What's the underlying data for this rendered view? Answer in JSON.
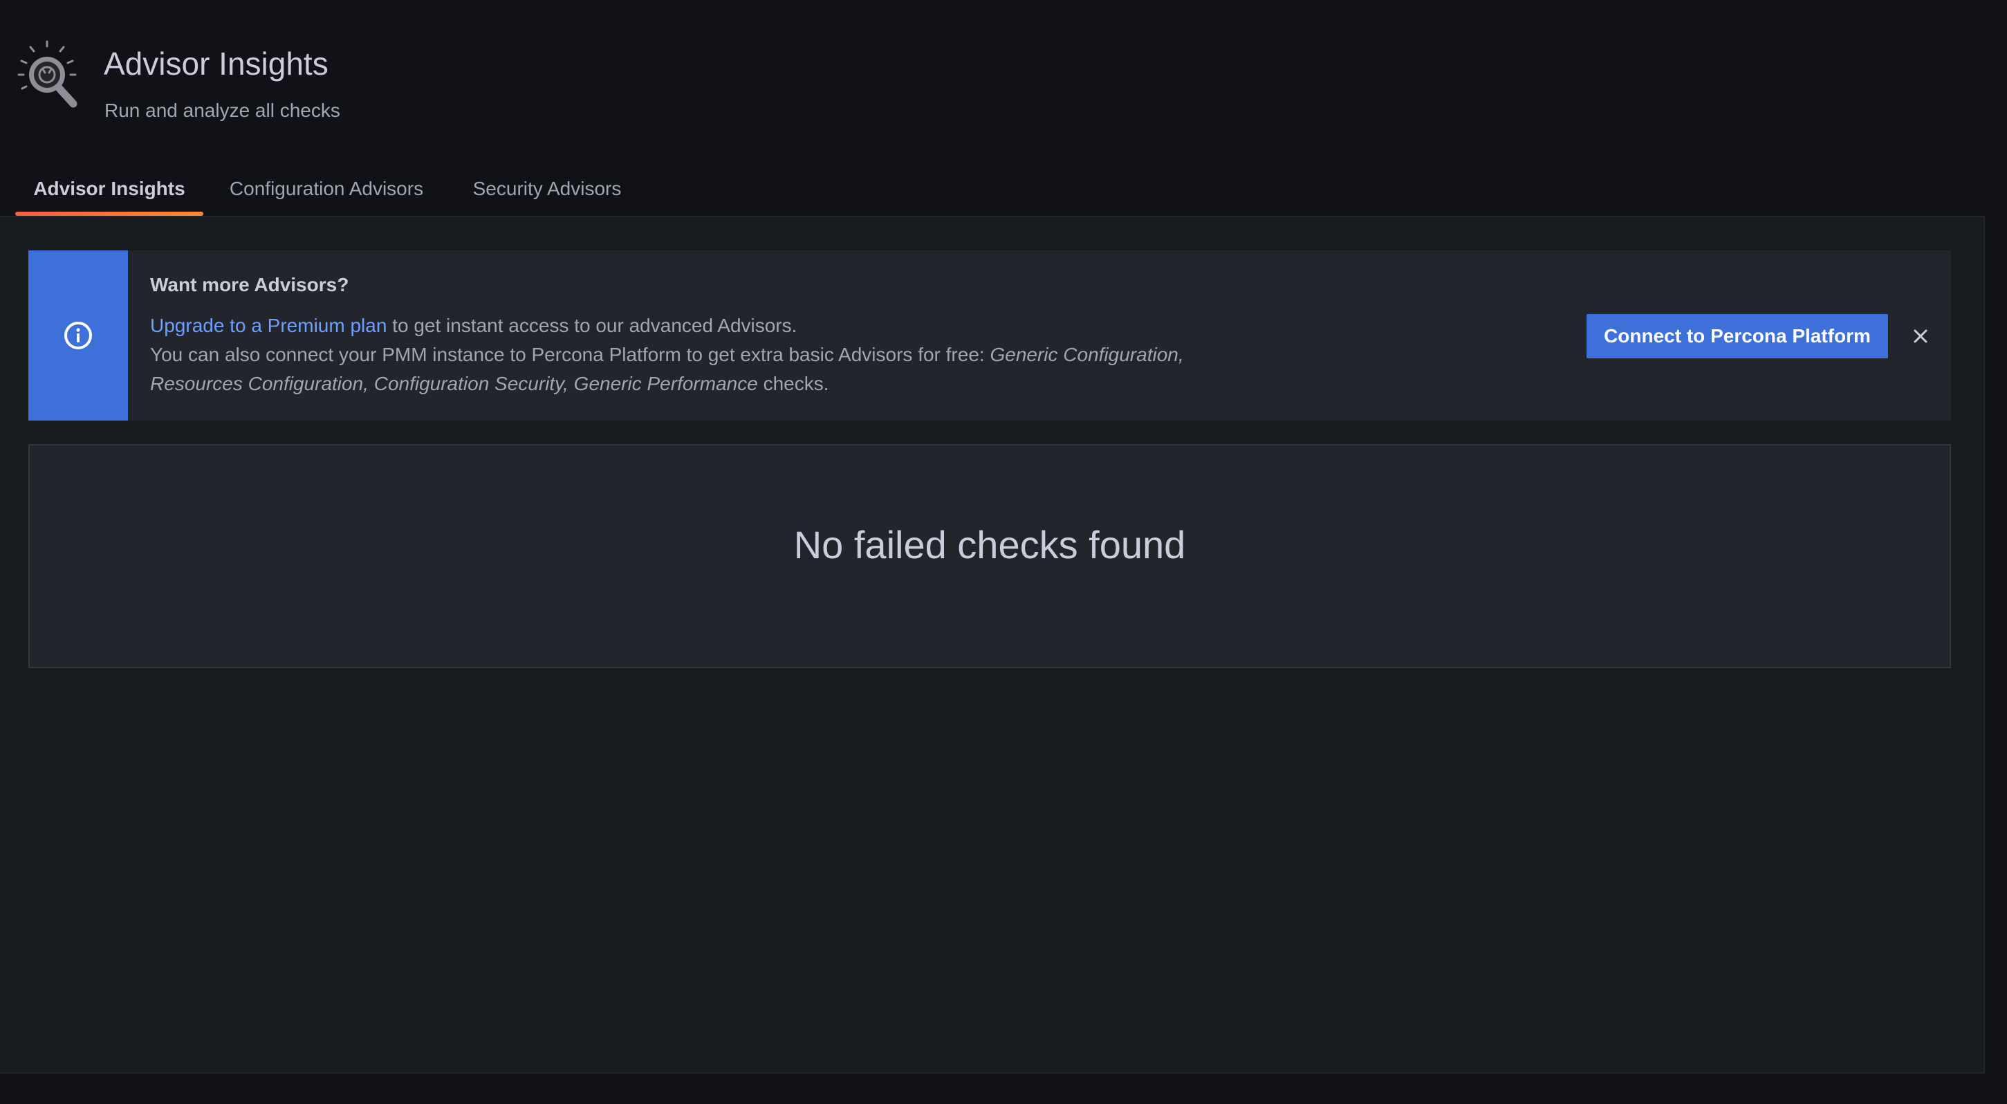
{
  "header": {
    "icon": "advisor-insights-icon",
    "title": "Advisor Insights",
    "subtitle": "Run and analyze all checks"
  },
  "tabs": [
    {
      "label": "Advisor Insights",
      "active": true
    },
    {
      "label": "Configuration Advisors",
      "active": false
    },
    {
      "label": "Security Advisors",
      "active": false
    }
  ],
  "alert": {
    "icon": "info-circle-icon",
    "title": "Want more Advisors?",
    "link_text": "Upgrade to a Premium plan",
    "line1_rest": " to get instant access to our advanced Advisors.",
    "line2_text": "You can also connect your PMM instance to Percona Platform to get extra basic Advisors for free: ",
    "line2_italic": "Generic Configuration,",
    "line3_italic": "Resources Configuration, Configuration Security, Generic Performance",
    "line3_rest": " checks.",
    "button_label": "Connect to Percona Platform",
    "close_icon": "close-icon"
  },
  "empty_state": {
    "message": "No failed checks found"
  },
  "colors": {
    "background": "#111217",
    "panel": "#181b1f",
    "card": "#22252b",
    "accent_blue": "#3d71d9",
    "link": "#6e9fff",
    "tab_underline": "#f55f3e"
  }
}
